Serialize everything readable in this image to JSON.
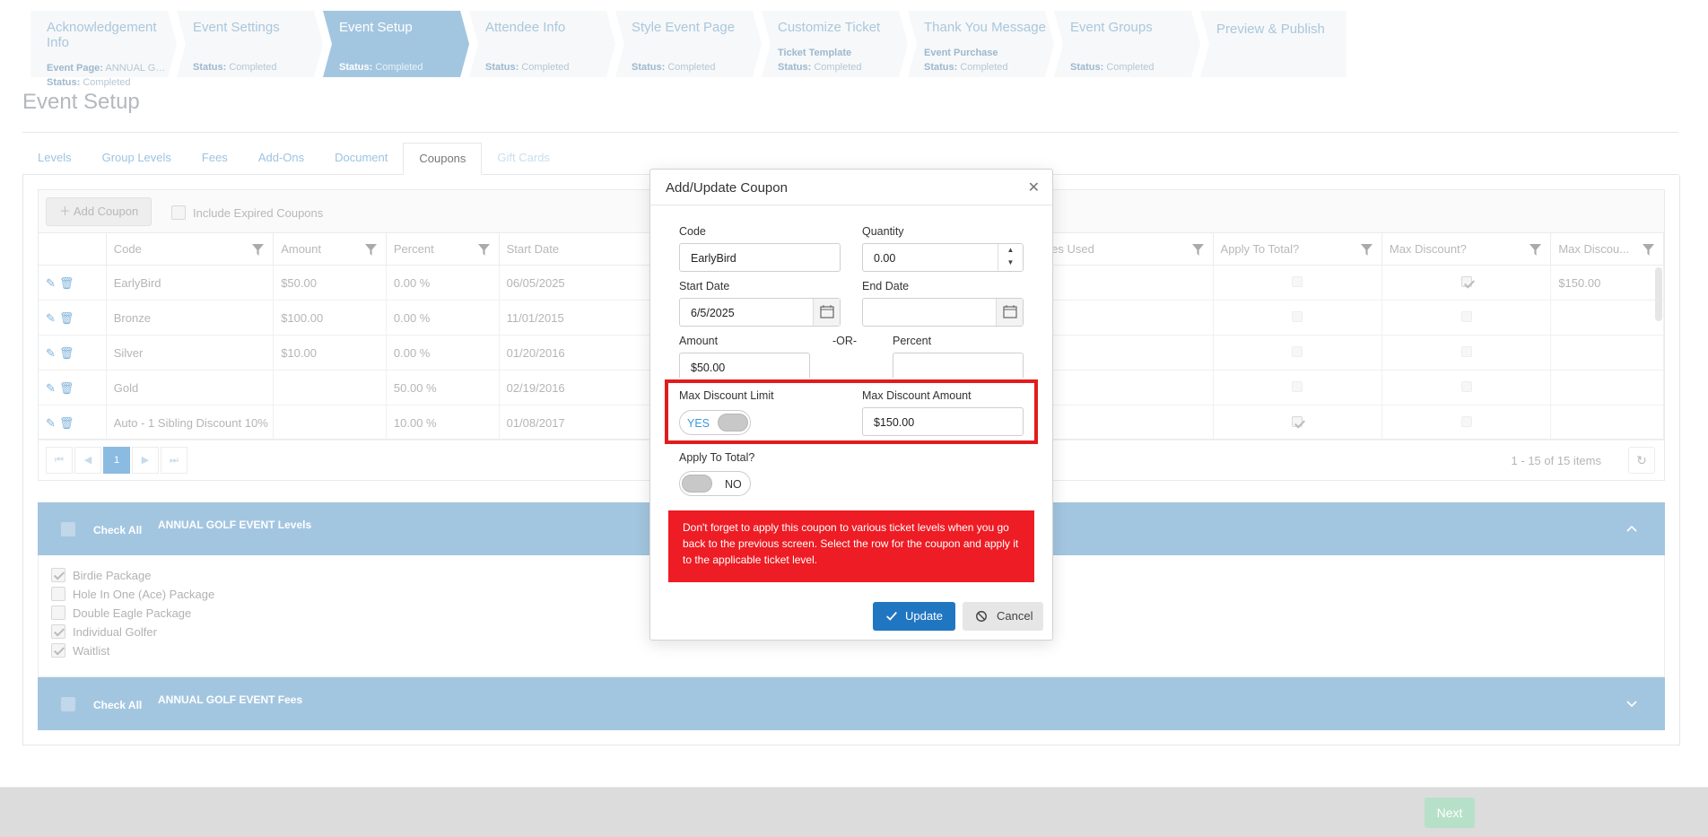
{
  "wizard": [
    {
      "title": "Acknowledgement Info",
      "sub_label": "Event Page:",
      "sub_value": "ANNUAL GOLF ...",
      "status_label": "Status:",
      "status_value": "Completed"
    },
    {
      "title": "Event Settings",
      "sub_label": "",
      "sub_value": "",
      "status_label": "Status:",
      "status_value": "Completed"
    },
    {
      "title": "Event Setup",
      "sub_label": "",
      "sub_value": "",
      "status_label": "Status:",
      "status_value": "Completed"
    },
    {
      "title": "Attendee Info",
      "sub_label": "",
      "sub_value": "",
      "status_label": "Status:",
      "status_value": "Completed"
    },
    {
      "title": "Style Event Page",
      "sub_label": "",
      "sub_value": "",
      "status_label": "Status:",
      "status_value": "Completed"
    },
    {
      "title": "Customize Ticket",
      "sub_label": "Ticket Template",
      "sub_value": "",
      "status_label": "Status:",
      "status_value": "Completed"
    },
    {
      "title": "Thank You Message",
      "sub_label": "Event Purchase",
      "sub_value": "",
      "status_label": "Status:",
      "status_value": "Completed"
    },
    {
      "title": "Event Groups",
      "sub_label": "",
      "sub_value": "",
      "status_label": "Status:",
      "status_value": "Completed"
    },
    {
      "title": "Preview & Publish",
      "sub_label": "",
      "sub_value": "",
      "status_label": "",
      "status_value": ""
    }
  ],
  "page_title": "Event Setup",
  "tabs": [
    "Levels",
    "Group Levels",
    "Fees",
    "Add-Ons",
    "Document",
    "Coupons",
    "Gift Cards"
  ],
  "grid": {
    "add_coupon": "Add Coupon",
    "include_expired": "Include Expired Coupons",
    "headers": [
      "Code",
      "Amount",
      "Percent",
      "Start Date",
      "es Used",
      "Apply To Total?",
      "Max Discount?",
      "Max Discou..."
    ],
    "rows": [
      {
        "code": "EarlyBird",
        "amount": "$50.00",
        "percent": "0.00 %",
        "start": "06/05/2025",
        "max_amount": "$150.00"
      },
      {
        "code": "Bronze",
        "amount": "$100.00",
        "percent": "0.00 %",
        "start": "11/01/2015",
        "max_amount": ""
      },
      {
        "code": "Silver",
        "amount": "$10.00",
        "percent": "0.00 %",
        "start": "01/20/2016",
        "max_amount": ""
      },
      {
        "code": "Gold",
        "amount": "",
        "percent": "50.00 %",
        "start": "02/19/2016",
        "max_amount": ""
      },
      {
        "code": "Auto - 1 Sibling Discount 10%",
        "amount": "",
        "percent": "10.00 %",
        "start": "01/08/2017",
        "max_amount": ""
      }
    ],
    "page": "1",
    "page_info": "1 - 15 of 15 items"
  },
  "levels_panel": {
    "check_all": "Check All",
    "title": "ANNUAL GOLF EVENT Levels",
    "items": [
      "Birdie Package",
      "Hole In One (Ace) Package",
      "Double Eagle Package",
      "Individual Golfer",
      "Waitlist"
    ]
  },
  "fees_panel": {
    "check_all": "Check All",
    "title": "ANNUAL GOLF EVENT Fees"
  },
  "footer": {
    "next": "Next"
  },
  "modal": {
    "title": "Add/Update Coupon",
    "code_label": "Code",
    "code_value": "EarlyBird",
    "quantity_label": "Quantity",
    "quantity_value": "0.00",
    "start_label": "Start Date",
    "start_value": "6/5/2025",
    "end_label": "End Date",
    "end_value": "",
    "amount_label": "Amount",
    "amount_value": "$50.00",
    "or_label": "-OR-",
    "percent_label": "Percent",
    "percent_value": "",
    "max_limit_label": "Max Discount Limit",
    "max_limit_toggle": "YES",
    "max_amount_label": "Max Discount Amount",
    "max_amount_value": "$150.00",
    "apply_total_label": "Apply To Total?",
    "apply_total_toggle": "NO",
    "alert": "Don't forget to apply this coupon to various ticket levels when you go back to the previous screen. Select the row for the coupon and apply it to the applicable ticket level.",
    "update": "Update",
    "cancel": "Cancel"
  },
  "colors": {
    "accent": "#2176c2",
    "alert": "#ee1c24",
    "highlight_border": "#e21c1c",
    "panel": "#a3c6e0"
  }
}
